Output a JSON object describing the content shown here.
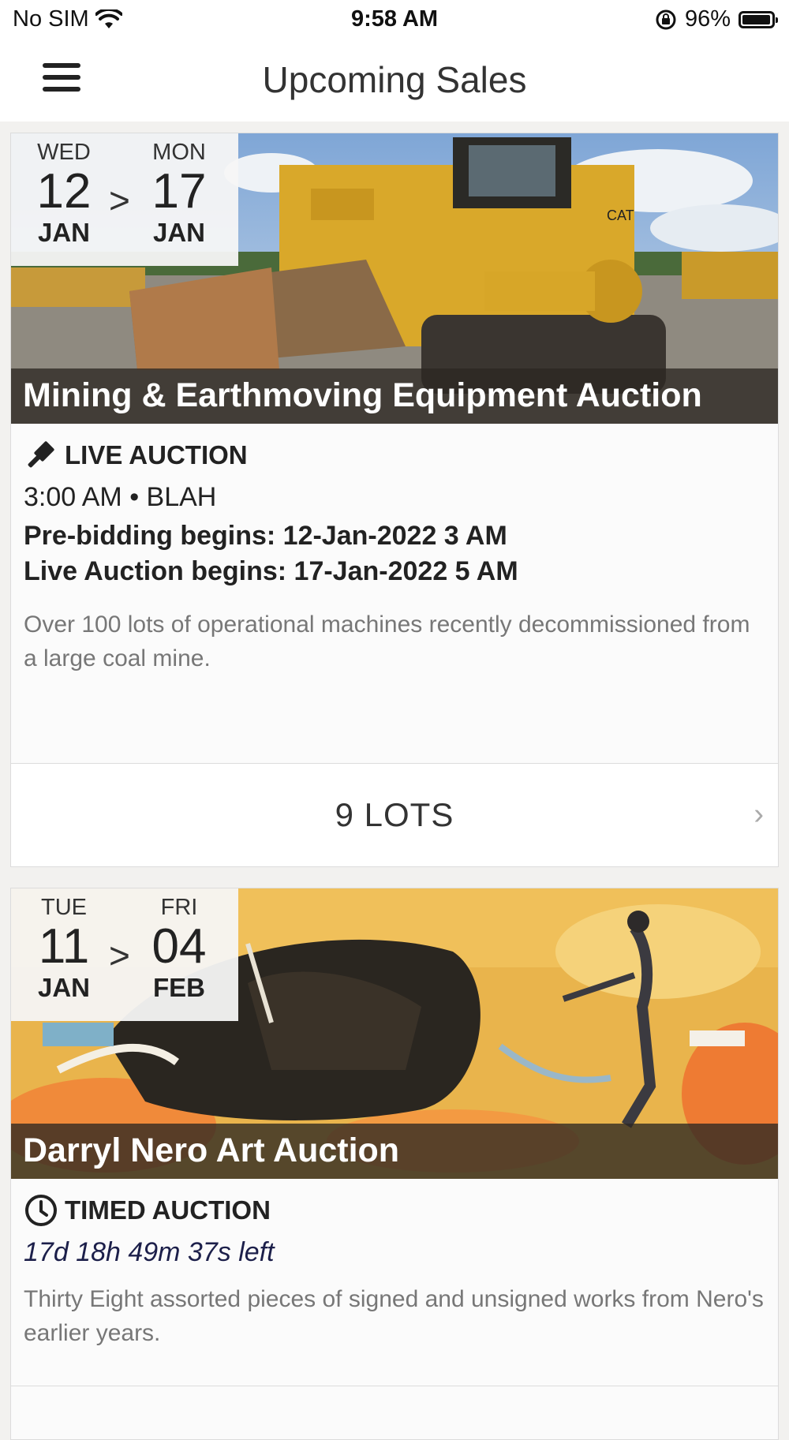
{
  "status_bar": {
    "carrier": "No SIM",
    "time": "9:58 AM",
    "battery": "96%",
    "battery_level": 0.96
  },
  "nav": {
    "title": "Upcoming Sales"
  },
  "sales": [
    {
      "start": {
        "dow": "WED",
        "day": "12",
        "month": "JAN"
      },
      "end": {
        "dow": "MON",
        "day": "17",
        "month": "JAN"
      },
      "separator": ">",
      "title": "Mining & Earthmoving Equipment Auction",
      "type_icon": "gavel-icon",
      "type": "LIVE AUCTION",
      "time_location": "3:00 AM • BLAH",
      "prebid": "Pre-bidding begins: 12-Jan-2022 3 AM",
      "live": "Live Auction begins: 17-Jan-2022 5 AM",
      "description": "Over 100 lots of operational machines recently decommissioned from a large coal mine.",
      "lots": "9 LOTS"
    },
    {
      "start": {
        "dow": "TUE",
        "day": "11",
        "month": "JAN"
      },
      "end": {
        "dow": "FRI",
        "day": "04",
        "month": "FEB"
      },
      "separator": ">",
      "title": "Darryl Nero Art Auction",
      "type_icon": "clock-icon",
      "type": "TIMED AUCTION",
      "countdown": "17d 18h 49m 37s left",
      "description": "Thirty Eight assorted pieces of signed and unsigned works from Nero's earlier years."
    }
  ]
}
